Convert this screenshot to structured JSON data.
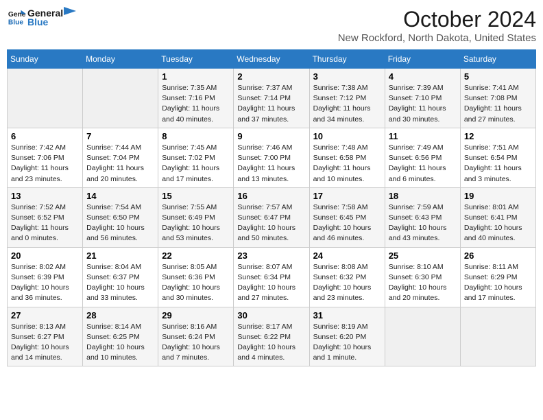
{
  "logo": {
    "line1": "General",
    "line2": "Blue"
  },
  "title": "October 2024",
  "location": "New Rockford, North Dakota, United States",
  "weekdays": [
    "Sunday",
    "Monday",
    "Tuesday",
    "Wednesday",
    "Thursday",
    "Friday",
    "Saturday"
  ],
  "weeks": [
    [
      {
        "day": "",
        "info": ""
      },
      {
        "day": "",
        "info": ""
      },
      {
        "day": "1",
        "info": "Sunrise: 7:35 AM\nSunset: 7:16 PM\nDaylight: 11 hours and 40 minutes."
      },
      {
        "day": "2",
        "info": "Sunrise: 7:37 AM\nSunset: 7:14 PM\nDaylight: 11 hours and 37 minutes."
      },
      {
        "day": "3",
        "info": "Sunrise: 7:38 AM\nSunset: 7:12 PM\nDaylight: 11 hours and 34 minutes."
      },
      {
        "day": "4",
        "info": "Sunrise: 7:39 AM\nSunset: 7:10 PM\nDaylight: 11 hours and 30 minutes."
      },
      {
        "day": "5",
        "info": "Sunrise: 7:41 AM\nSunset: 7:08 PM\nDaylight: 11 hours and 27 minutes."
      }
    ],
    [
      {
        "day": "6",
        "info": "Sunrise: 7:42 AM\nSunset: 7:06 PM\nDaylight: 11 hours and 23 minutes."
      },
      {
        "day": "7",
        "info": "Sunrise: 7:44 AM\nSunset: 7:04 PM\nDaylight: 11 hours and 20 minutes."
      },
      {
        "day": "8",
        "info": "Sunrise: 7:45 AM\nSunset: 7:02 PM\nDaylight: 11 hours and 17 minutes."
      },
      {
        "day": "9",
        "info": "Sunrise: 7:46 AM\nSunset: 7:00 PM\nDaylight: 11 hours and 13 minutes."
      },
      {
        "day": "10",
        "info": "Sunrise: 7:48 AM\nSunset: 6:58 PM\nDaylight: 11 hours and 10 minutes."
      },
      {
        "day": "11",
        "info": "Sunrise: 7:49 AM\nSunset: 6:56 PM\nDaylight: 11 hours and 6 minutes."
      },
      {
        "day": "12",
        "info": "Sunrise: 7:51 AM\nSunset: 6:54 PM\nDaylight: 11 hours and 3 minutes."
      }
    ],
    [
      {
        "day": "13",
        "info": "Sunrise: 7:52 AM\nSunset: 6:52 PM\nDaylight: 11 hours and 0 minutes."
      },
      {
        "day": "14",
        "info": "Sunrise: 7:54 AM\nSunset: 6:50 PM\nDaylight: 10 hours and 56 minutes."
      },
      {
        "day": "15",
        "info": "Sunrise: 7:55 AM\nSunset: 6:49 PM\nDaylight: 10 hours and 53 minutes."
      },
      {
        "day": "16",
        "info": "Sunrise: 7:57 AM\nSunset: 6:47 PM\nDaylight: 10 hours and 50 minutes."
      },
      {
        "day": "17",
        "info": "Sunrise: 7:58 AM\nSunset: 6:45 PM\nDaylight: 10 hours and 46 minutes."
      },
      {
        "day": "18",
        "info": "Sunrise: 7:59 AM\nSunset: 6:43 PM\nDaylight: 10 hours and 43 minutes."
      },
      {
        "day": "19",
        "info": "Sunrise: 8:01 AM\nSunset: 6:41 PM\nDaylight: 10 hours and 40 minutes."
      }
    ],
    [
      {
        "day": "20",
        "info": "Sunrise: 8:02 AM\nSunset: 6:39 PM\nDaylight: 10 hours and 36 minutes."
      },
      {
        "day": "21",
        "info": "Sunrise: 8:04 AM\nSunset: 6:37 PM\nDaylight: 10 hours and 33 minutes."
      },
      {
        "day": "22",
        "info": "Sunrise: 8:05 AM\nSunset: 6:36 PM\nDaylight: 10 hours and 30 minutes."
      },
      {
        "day": "23",
        "info": "Sunrise: 8:07 AM\nSunset: 6:34 PM\nDaylight: 10 hours and 27 minutes."
      },
      {
        "day": "24",
        "info": "Sunrise: 8:08 AM\nSunset: 6:32 PM\nDaylight: 10 hours and 23 minutes."
      },
      {
        "day": "25",
        "info": "Sunrise: 8:10 AM\nSunset: 6:30 PM\nDaylight: 10 hours and 20 minutes."
      },
      {
        "day": "26",
        "info": "Sunrise: 8:11 AM\nSunset: 6:29 PM\nDaylight: 10 hours and 17 minutes."
      }
    ],
    [
      {
        "day": "27",
        "info": "Sunrise: 8:13 AM\nSunset: 6:27 PM\nDaylight: 10 hours and 14 minutes."
      },
      {
        "day": "28",
        "info": "Sunrise: 8:14 AM\nSunset: 6:25 PM\nDaylight: 10 hours and 10 minutes."
      },
      {
        "day": "29",
        "info": "Sunrise: 8:16 AM\nSunset: 6:24 PM\nDaylight: 10 hours and 7 minutes."
      },
      {
        "day": "30",
        "info": "Sunrise: 8:17 AM\nSunset: 6:22 PM\nDaylight: 10 hours and 4 minutes."
      },
      {
        "day": "31",
        "info": "Sunrise: 8:19 AM\nSunset: 6:20 PM\nDaylight: 10 hours and 1 minute."
      },
      {
        "day": "",
        "info": ""
      },
      {
        "day": "",
        "info": ""
      }
    ]
  ]
}
